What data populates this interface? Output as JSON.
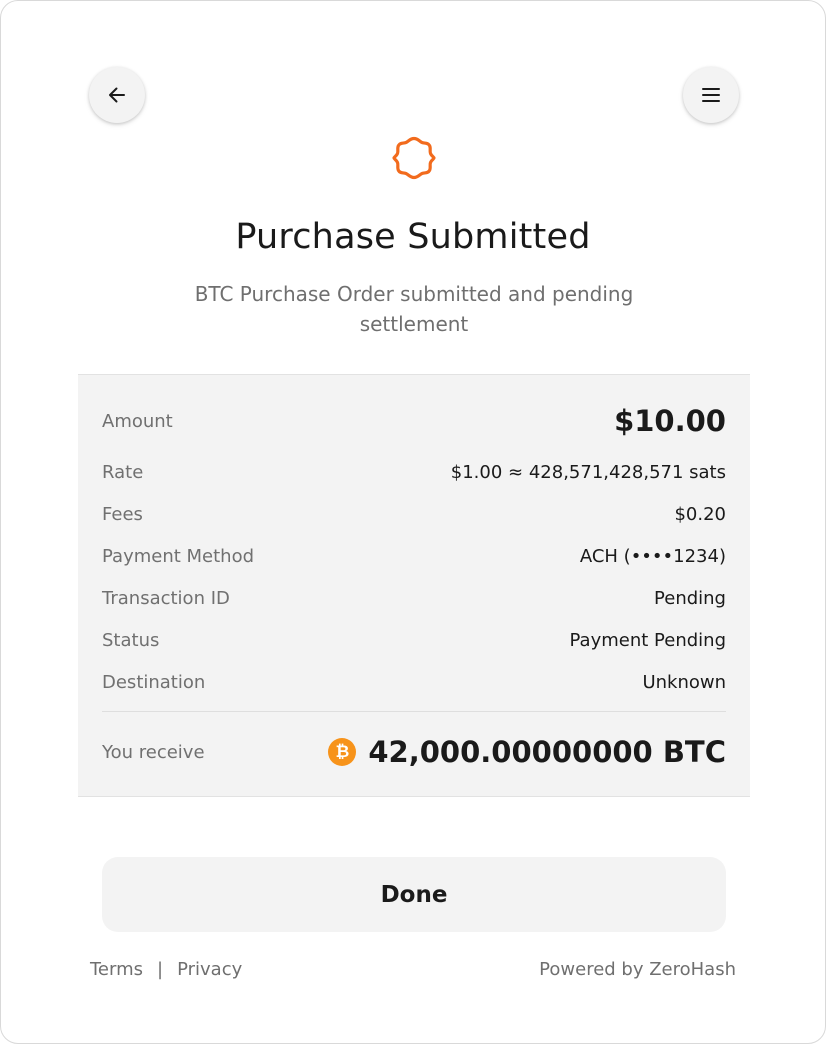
{
  "header": {
    "back_icon": "arrow-left-icon",
    "menu_icon": "hamburger-menu-icon"
  },
  "status": {
    "icon": "pending-badge-icon",
    "icon_color": "#f26b1d",
    "title": "Purchase Submitted",
    "subtitle": "BTC Purchase Order submitted and pending settlement"
  },
  "details": {
    "amount_label": "Amount",
    "amount_value": "$10.00",
    "rate_label": "Rate",
    "rate_value": "$1.00 ≈ 428,571,428,571 sats",
    "fees_label": "Fees",
    "fees_value": "$0.20",
    "payment_method_label": "Payment Method",
    "payment_method_value": "ACH (••••1234)",
    "transaction_id_label": "Transaction ID",
    "transaction_id_value": "Pending",
    "status_label": "Status",
    "status_value": "Payment Pending",
    "destination_label": "Destination",
    "destination_value": "Unknown",
    "receive_label": "You receive",
    "receive_coin_icon": "bitcoin-icon",
    "receive_coin_glyph": "₿",
    "receive_coin_color": "#f7931a",
    "receive_value": "42,000.00000000 BTC"
  },
  "actions": {
    "done_label": "Done"
  },
  "footer": {
    "terms_label": "Terms",
    "separator": "|",
    "privacy_label": "Privacy",
    "powered_by": "Powered by ZeroHash"
  }
}
